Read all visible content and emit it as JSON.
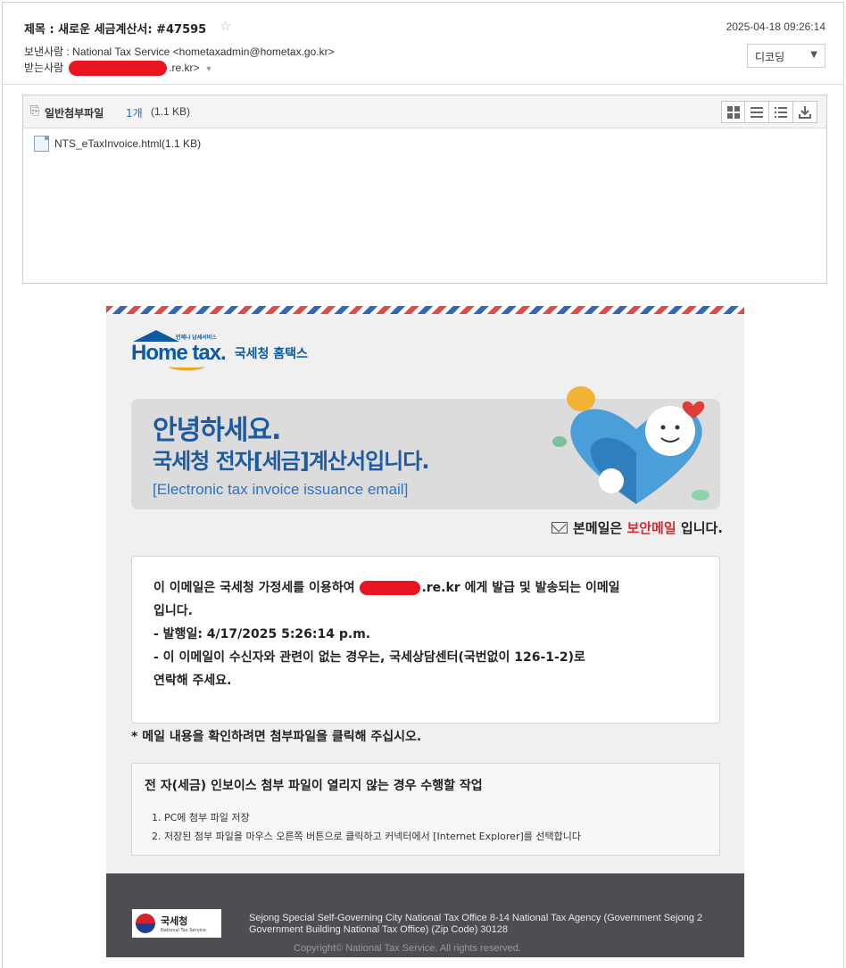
{
  "header": {
    "subject": "제목 : 새로운 세금계산서: #47595",
    "date": "2025-04-18 09:26:14",
    "from_label": "보낸사람 : ",
    "from_value": "National Tax Service <hometaxadmin@hometax.go.kr>",
    "to_label": "받는사람",
    "to_suffix": ".re.kr>",
    "decode_label": "디코딩"
  },
  "attachments": {
    "title": "일반첨부파일",
    "count": "1개",
    "size": "(1.1 KB)",
    "files": [
      {
        "name": "NTS_eTaxInvoice.html(1.1 KB)"
      }
    ]
  },
  "mail": {
    "logo_text": "Home tax.",
    "logo_small": "언제나 납세서비스",
    "logo_ko": "국세청 홈택스",
    "greeting": "안녕하세요.",
    "greeting2": "국세청 전자[세금]계산서입니다.",
    "greeting3": "[Electronic tax invoice issuance email]",
    "secure_prefix": "본메일은",
    "secure_highlight": "보안메일",
    "secure_suffix": "입니다.",
    "info_line1_prefix": "이 이메일은 국세청 가정세를 이용하여",
    "info_line1_suffix": ".re.kr 에게 발급 및 발송되는 이메일",
    "info_line2": "입니다.",
    "info_line3": "- 발행일: 4/17/2025 5:26:14 p.m.",
    "info_line4": "- 이 이메일이 수신자와 관련이 없는 경우는, 국세상담센터(국번없이 126-1-2)로",
    "info_line5": "연락해 주세요.",
    "note": "* 메일 내용을 확인하려면 첨부파일을 클릭해 주십시오.",
    "steps_title": "전 자(세금) 인보이스 첨부 파일이 열리지 않는 경우 수행할 작업",
    "steps": [
      "1. PC에 첨부 파일 저장",
      "2. 저장된 첨부 파일을 마우스 오른쪽 버튼으로 클릭하고 커넥터에서 [Internet Explorer]를 선택합니다"
    ],
    "footer_logo_ko": "국세청",
    "footer_logo_en": "National Tax Service",
    "footer_address": "Sejong Special Self-Governing City National Tax Office 8-14 National Tax Agency (Government Sejong 2 Government Building National Tax Office) (Zip Code) 30128",
    "copyright": "Copyright© National Tax Service. All rights reserved."
  },
  "colors": {
    "brand_blue": "#1d5aa0",
    "secure_red": "#d92a2a",
    "footer_bg": "#4d4d52"
  }
}
